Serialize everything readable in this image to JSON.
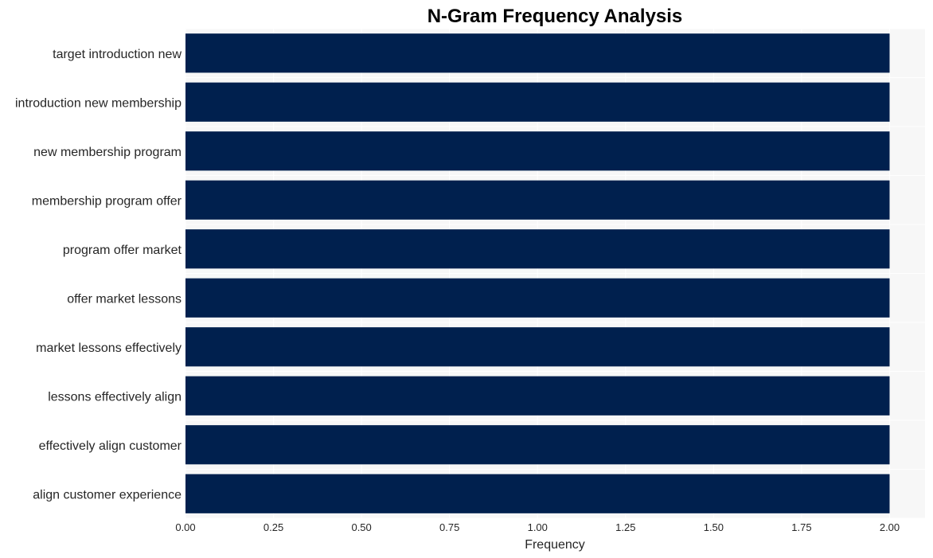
{
  "chart_data": {
    "type": "bar",
    "orientation": "horizontal",
    "title": "N-Gram Frequency Analysis",
    "xlabel": "Frequency",
    "ylabel": "",
    "categories": [
      "target introduction new",
      "introduction new membership",
      "new membership program",
      "membership program offer",
      "program offer market",
      "offer market lessons",
      "market lessons effectively",
      "lessons effectively align",
      "effectively align customer",
      "align customer experience"
    ],
    "values": [
      2,
      2,
      2,
      2,
      2,
      2,
      2,
      2,
      2,
      2
    ],
    "xlim": [
      0,
      2.1
    ],
    "xticks": [
      0.0,
      0.25,
      0.5,
      0.75,
      1.0,
      1.25,
      1.5,
      1.75,
      2.0
    ],
    "xtick_labels": [
      "0.00",
      "0.25",
      "0.50",
      "0.75",
      "1.00",
      "1.25",
      "1.50",
      "1.75",
      "2.00"
    ],
    "grid": true,
    "legend": null,
    "colors": {
      "bar": "#00204e",
      "plot_background": "#f7f7f7",
      "grid": "#ffffff",
      "text": "#262626"
    }
  }
}
